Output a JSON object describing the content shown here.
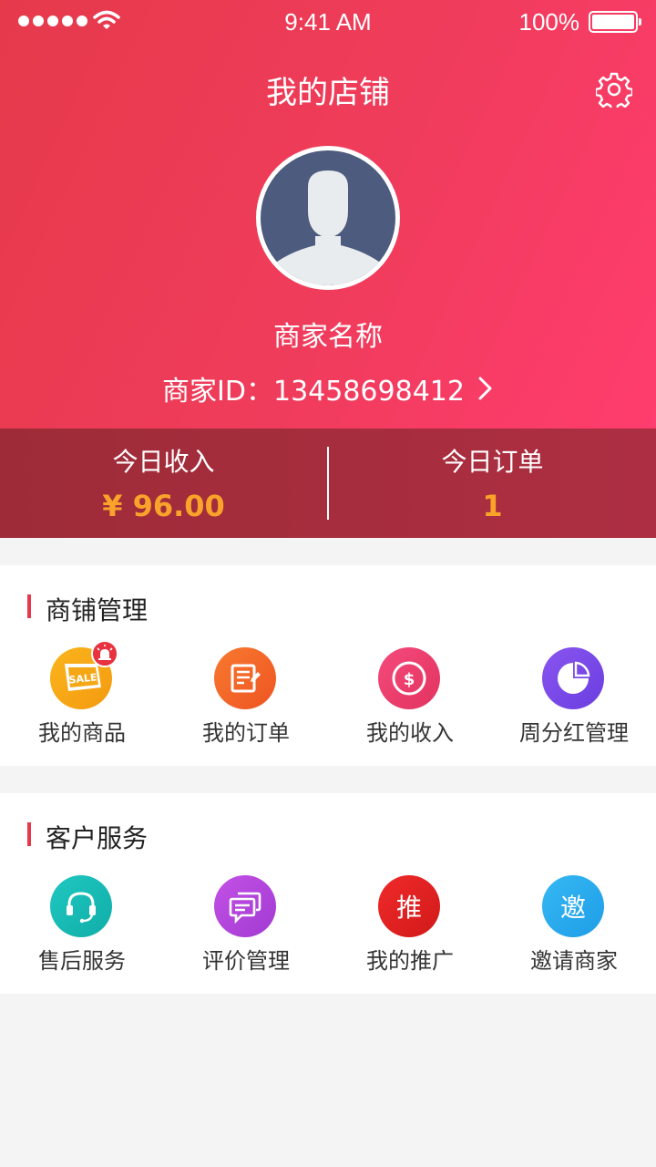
{
  "status_bar": {
    "time": "9:41 AM",
    "battery": "100%"
  },
  "header": {
    "title": "我的店铺",
    "merchant_name": "商家名称",
    "merchant_id": "商家ID：13458698412"
  },
  "stats": {
    "income_label": "今日收入",
    "income_value": "¥ 96.00",
    "orders_label": "今日订单",
    "orders_value": "1"
  },
  "shop_management": {
    "title": "商铺管理",
    "items": [
      {
        "label": "我的商品",
        "icon": "sale-tag-icon"
      },
      {
        "label": "我的订单",
        "icon": "order-edit-icon"
      },
      {
        "label": "我的收入",
        "icon": "dollar-coin-icon"
      },
      {
        "label": "周分红管理",
        "icon": "pie-chart-icon"
      }
    ]
  },
  "customer_service": {
    "title": "客户服务",
    "items": [
      {
        "label": "售后服务",
        "icon": "headset-icon"
      },
      {
        "label": "评价管理",
        "icon": "chat-bubbles-icon"
      },
      {
        "label": "我的推广",
        "icon_text": "推"
      },
      {
        "label": "邀请商家",
        "icon_text": "邀"
      }
    ]
  },
  "colors": {
    "header_gradient_start": "#e63a4b",
    "header_gradient_end": "#ff3d6e",
    "stats_bg": "#a52d3d",
    "accent_value": "#f9a32a",
    "section_marker": "#e63a4b"
  }
}
